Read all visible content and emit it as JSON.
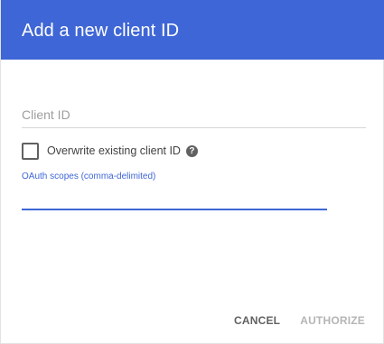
{
  "dialog": {
    "title": "Add a new client ID",
    "header_color": "#3e66d6"
  },
  "client_id": {
    "placeholder": "Client ID",
    "value": ""
  },
  "overwrite": {
    "label": "Overwrite existing client ID",
    "checked": false,
    "help_icon": "help-circle-icon",
    "help_glyph": "?"
  },
  "scopes": {
    "label": "OAuth scopes (comma-delimited)",
    "value": ""
  },
  "actions": {
    "cancel_label": "CANCEL",
    "authorize_label": "AUTHORIZE",
    "authorize_enabled": false
  }
}
